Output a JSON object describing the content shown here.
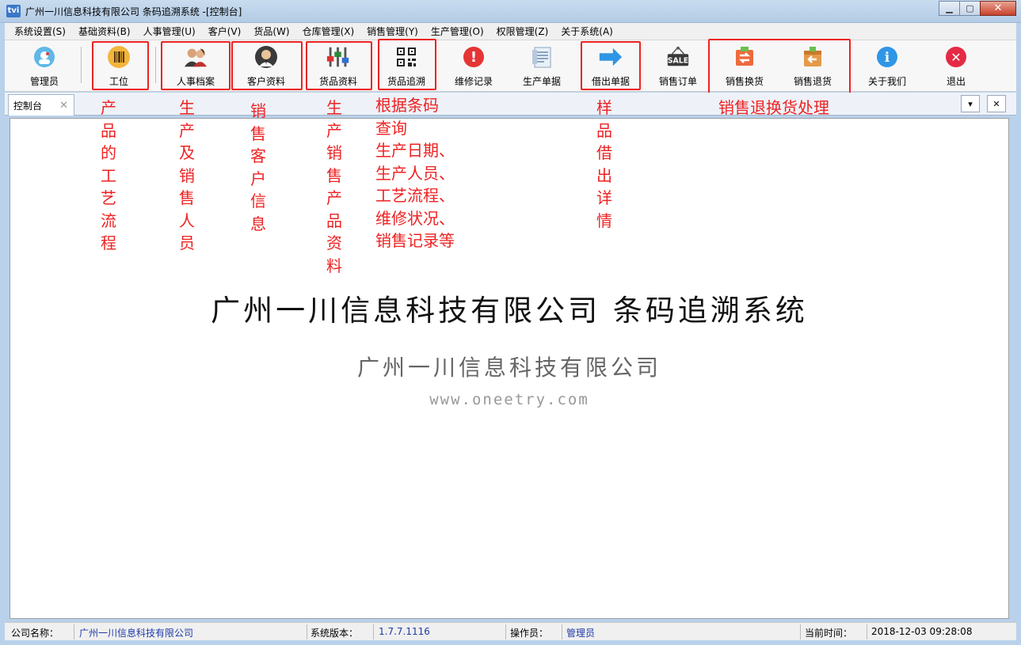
{
  "window": {
    "app_icon": "tvi",
    "title": "广州一川信息科技有限公司 条码追溯系统 -[控制台]",
    "minimize": "▁",
    "maximize": "▢",
    "close": "✕"
  },
  "menu": [
    "系统设置(S)",
    "基础资料(B)",
    "人事管理(U)",
    "客户(V)",
    "货品(W)",
    "仓库管理(X)",
    "销售管理(Y)",
    "生产管理(O)",
    "权限管理(Z)",
    "关于系统(A)"
  ],
  "toolbar": [
    {
      "label": "管理员",
      "icon": "admin-icon",
      "color": "#4aa6d8"
    },
    {
      "label": "工位",
      "icon": "workstation-icon",
      "color": "#e0a030"
    },
    {
      "label": "人事档案",
      "icon": "personnel-icon",
      "color": "#444444"
    },
    {
      "label": "客户资料",
      "icon": "customer-icon",
      "color": "#333333"
    },
    {
      "label": "货品资料",
      "icon": "goods-icon",
      "color": "#2a8a3a"
    },
    {
      "label": "货品追溯",
      "icon": "qrcode-icon",
      "color": "#222222"
    },
    {
      "label": "维修记录",
      "icon": "repair-icon",
      "color": "#e03030"
    },
    {
      "label": "生产单据",
      "icon": "production-doc-icon",
      "color": "#6b8fb5"
    },
    {
      "label": "借出单据",
      "icon": "lend-doc-icon",
      "color": "#2f8fe0"
    },
    {
      "label": "销售订单",
      "icon": "sale-order-icon",
      "color": "#333333"
    },
    {
      "label": "销售换货",
      "icon": "exchange-icon",
      "color": "#e8603a"
    },
    {
      "label": "销售退货",
      "icon": "return-icon",
      "color": "#d98a3a"
    },
    {
      "label": "关于我们",
      "icon": "info-icon",
      "color": "#2f8fe0"
    },
    {
      "label": "退出",
      "icon": "exit-icon",
      "color": "#e0203a"
    }
  ],
  "sale_badge": "SALE",
  "info_glyph": "i",
  "exit_glyph": "✕",
  "repair_glyph": "!",
  "tab": {
    "label": "控制台",
    "close": "✕"
  },
  "tab_menu_btn": "▾",
  "tab_close_btn": "✕",
  "annotations": {
    "workstation": "产品的工艺流程",
    "personnel": "生产及销售人员",
    "customer": "销售客户信息",
    "goods": "生产销售产品资料",
    "trace_lines": [
      "根据条码",
      "查询",
      "生产日期、",
      "生产人员、",
      "工艺流程、",
      "维修状况、",
      "销售记录等"
    ],
    "lend": "样品借出详情",
    "exchange": "销售退换货处理"
  },
  "content": {
    "title": "广州一川信息科技有限公司 条码追溯系统",
    "subtitle": "广州一川信息科技有限公司",
    "website": "www.oneetry.com"
  },
  "status": {
    "company_label": "公司名称：",
    "company_value": "广州一川信息科技有限公司",
    "version_label": "系统版本：",
    "version_value": "1.7.7.1116",
    "operator_label": "操作员：",
    "operator_value": "管理员",
    "time_label": "当前时间：",
    "time_value": "2018-12-03 09:28:08"
  },
  "colors": {
    "annotation": "#ee2222",
    "status_value": "#1f3aa8"
  }
}
